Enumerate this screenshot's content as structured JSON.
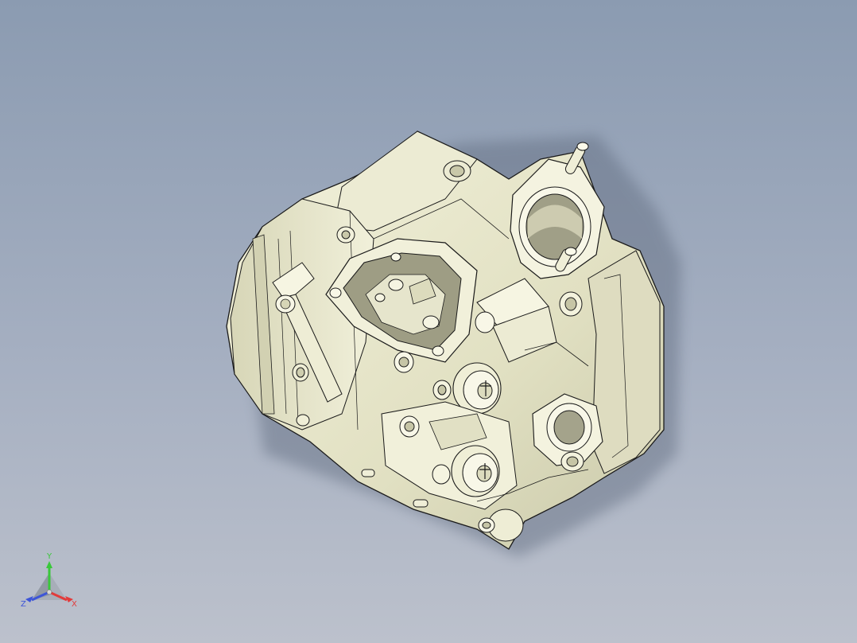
{
  "viewport": {
    "background_top": "#8b9bb1",
    "background_bottom": "#bcc1cc"
  },
  "model": {
    "body_color": "#e4e3c6",
    "edge_color": "#1a1a1a",
    "shadow_color": "#5e6a7e"
  },
  "triad": {
    "x_label": "X",
    "y_label": "Y",
    "z_label": "Z",
    "x_color": "#e23b3b",
    "y_color": "#39c83a",
    "z_color": "#3d55d8"
  }
}
